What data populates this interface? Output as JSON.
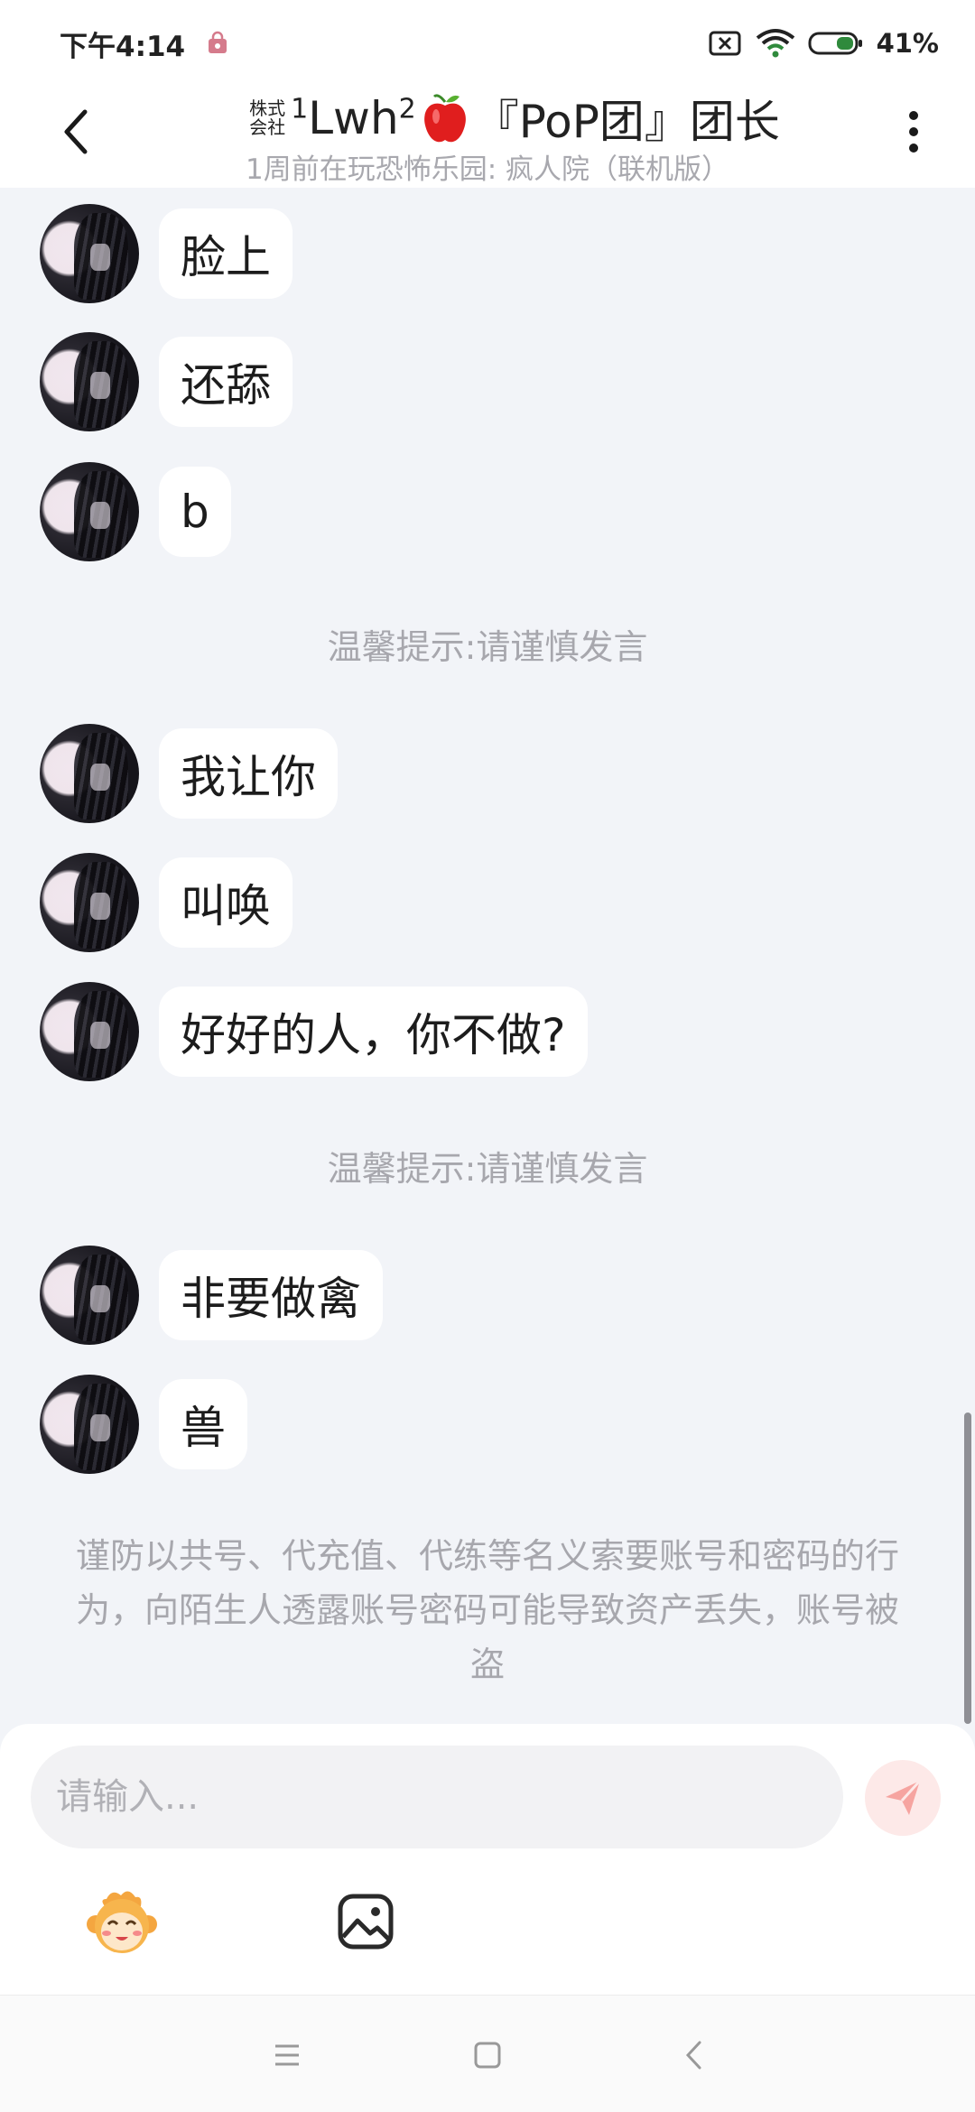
{
  "status_bar": {
    "time": "下午4:14",
    "battery": "41%"
  },
  "header": {
    "title_prefix_top": "株式",
    "title_prefix_bottom": "会社",
    "title_sup1": "1",
    "title_name": "Lwh",
    "title_sup2": "2",
    "title_suffix": "『PoP团』团长",
    "subtitle": "1周前在玩恐怖乐园: 疯人院（联机版）"
  },
  "messages": [
    {
      "text": "脸上"
    },
    {
      "text": "还舔"
    },
    {
      "text": "b"
    },
    {
      "text": "我让你"
    },
    {
      "text": "叫唤"
    },
    {
      "text": "好好的人，你不做?"
    },
    {
      "text": "非要做禽"
    },
    {
      "text": "兽"
    }
  ],
  "tips": {
    "tip1": "温馨提示:请谨慎发言",
    "tip2": "温馨提示:请谨慎发言"
  },
  "warning": "谨防以共号、代充值、代练等名义索要账号和密码的行为，向陌生人透露账号密码可能导致资产丢失，账号被盗",
  "input": {
    "placeholder": "请输入..."
  },
  "colors": {
    "background": "#f2f4f8",
    "bubble": "#ffffff",
    "send_button": "#fde9e8",
    "send_icon": "#f6a4a0",
    "hint_text": "#a7a7ad"
  },
  "icons": {
    "back": "chevron-left-icon",
    "more": "more-vertical-icon",
    "send": "paper-plane-icon",
    "emoji": "monkey-emoji-icon",
    "image": "image-icon",
    "apple": "apple-icon"
  }
}
